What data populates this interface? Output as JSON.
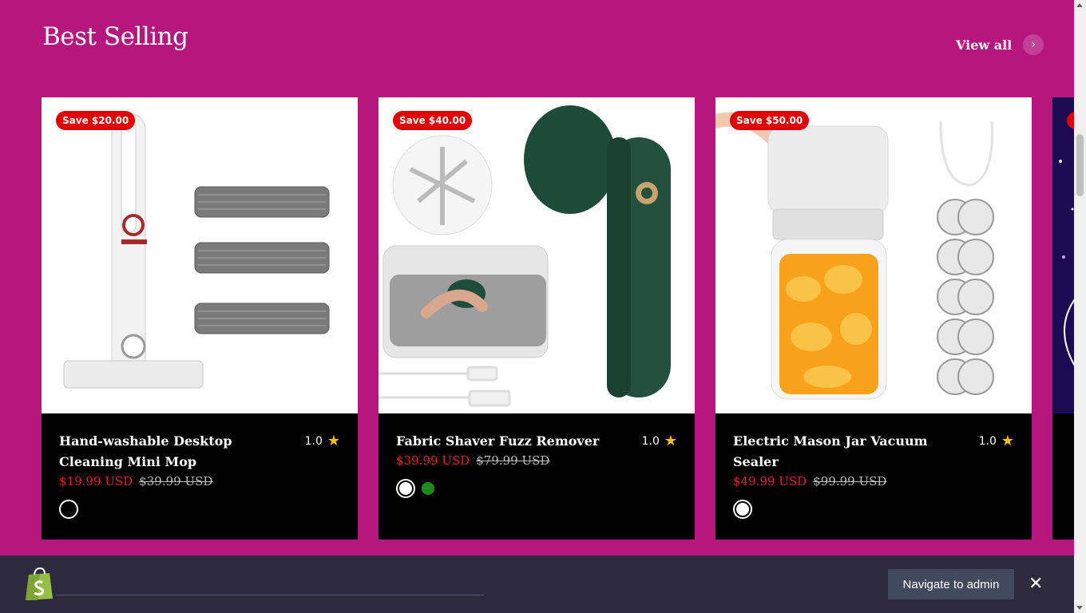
{
  "section": {
    "title": "Best Selling",
    "view_all_label": "View all",
    "view_all_icon": "chevron-right-icon"
  },
  "products": [
    {
      "badge": "Save $20.00",
      "title": "Hand-washable Desktop Cleaning Mini Mop",
      "rating": "1.0",
      "price_sale": "$19.99 USD",
      "price_old": "$39.99 USD",
      "swatches": [
        "#ffffff"
      ]
    },
    {
      "badge": "Save $40.00",
      "title": "Fabric Shaver Fuzz Remover",
      "rating": "1.0",
      "price_sale": "$39.99 USD",
      "price_old": "$79.99 USD",
      "swatches": [
        "#ffffff",
        "#1e8a1e"
      ]
    },
    {
      "badge": "Save $50.00",
      "title": "Electric Mason Jar Vacuum Sealer",
      "rating": "1.0",
      "price_sale": "$49.99 USD",
      "price_old": "$99.99 USD",
      "swatches": [
        "#ffffff"
      ]
    }
  ],
  "admin_bar": {
    "navigate_label": "Navigate to admin",
    "close_icon": "close-icon",
    "logo_icon": "shopify-bag-icon"
  },
  "colors": {
    "background": "#b5177f",
    "sale_red": "#e02020",
    "badge_red": "#e00000",
    "star": "#f6c200",
    "admin_bar": "#2e2a3e"
  }
}
